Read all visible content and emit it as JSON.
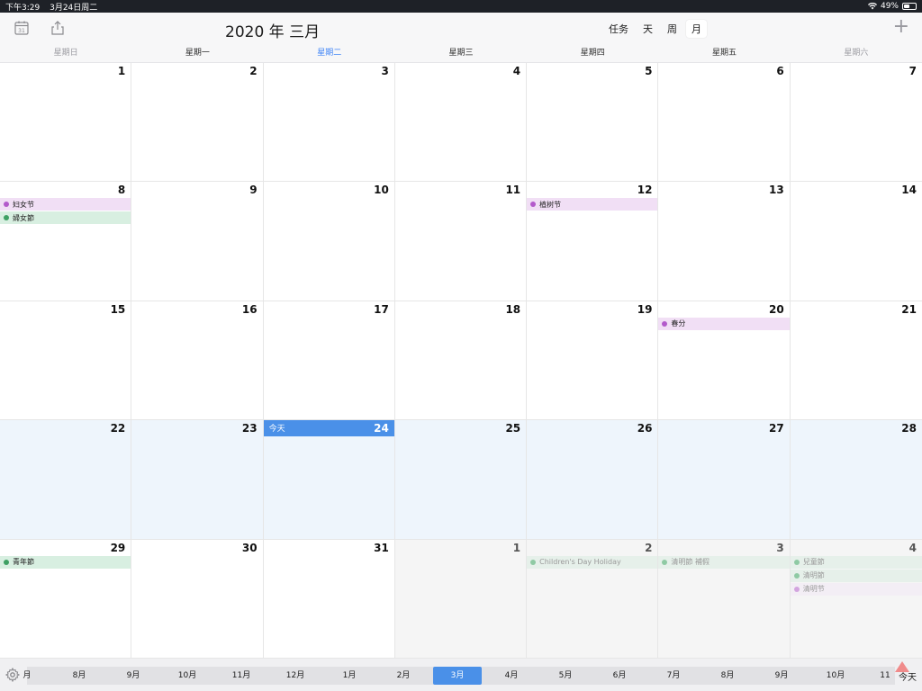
{
  "status_bar": {
    "time": "下午3:29",
    "date": "3月24日周二",
    "battery": "49%"
  },
  "header": {
    "title": "2020 年 三月",
    "views": [
      {
        "label": "任务",
        "active": false
      },
      {
        "label": "天",
        "active": false
      },
      {
        "label": "周",
        "active": false
      },
      {
        "label": "月",
        "active": true
      }
    ],
    "add_label": "+"
  },
  "weekdays": [
    {
      "label": "星期日",
      "weekend": true,
      "today": false
    },
    {
      "label": "星期一",
      "weekend": false,
      "today": false
    },
    {
      "label": "星期二",
      "weekend": false,
      "today": true
    },
    {
      "label": "星期三",
      "weekend": false,
      "today": false
    },
    {
      "label": "星期四",
      "weekend": false,
      "today": false
    },
    {
      "label": "星期五",
      "weekend": false,
      "today": false
    },
    {
      "label": "星期六",
      "weekend": true,
      "today": false
    }
  ],
  "today_label": "今天",
  "weeks": [
    [
      {
        "day": "1"
      },
      {
        "day": "2"
      },
      {
        "day": "3"
      },
      {
        "day": "4"
      },
      {
        "day": "5"
      },
      {
        "day": "6"
      },
      {
        "day": "7"
      }
    ],
    [
      {
        "day": "8",
        "events": [
          {
            "title": "妇女节",
            "color": "purple"
          },
          {
            "title": "婦女節",
            "color": "green"
          }
        ]
      },
      {
        "day": "9"
      },
      {
        "day": "10"
      },
      {
        "day": "11"
      },
      {
        "day": "12",
        "events": [
          {
            "title": "植树节",
            "color": "purple"
          }
        ]
      },
      {
        "day": "13"
      },
      {
        "day": "14"
      }
    ],
    [
      {
        "day": "15"
      },
      {
        "day": "16"
      },
      {
        "day": "17"
      },
      {
        "day": "18"
      },
      {
        "day": "19"
      },
      {
        "day": "20",
        "events": [
          {
            "title": "春分",
            "color": "purple"
          }
        ]
      },
      {
        "day": "21"
      }
    ],
    [
      {
        "day": "22",
        "current_week": true
      },
      {
        "day": "23",
        "current_week": true
      },
      {
        "day": "24",
        "current_week": true,
        "today": true
      },
      {
        "day": "25",
        "current_week": true
      },
      {
        "day": "26",
        "current_week": true
      },
      {
        "day": "27",
        "current_week": true
      },
      {
        "day": "28",
        "current_week": true
      }
    ],
    [
      {
        "day": "29",
        "events": [
          {
            "title": "青年節",
            "color": "green"
          }
        ]
      },
      {
        "day": "30"
      },
      {
        "day": "31"
      },
      {
        "day": "1",
        "other_month": true
      },
      {
        "day": "2",
        "other_month": true,
        "events": [
          {
            "title": "Children's Day Holiday",
            "color": "green"
          }
        ]
      },
      {
        "day": "3",
        "other_month": true,
        "events": [
          {
            "title": "清明節 補假",
            "color": "green"
          }
        ]
      },
      {
        "day": "4",
        "other_month": true,
        "events": [
          {
            "title": "兒童節",
            "color": "green"
          },
          {
            "title": "清明節",
            "color": "green"
          },
          {
            "title": "清明节",
            "color": "purple"
          }
        ]
      }
    ]
  ],
  "month_strip": [
    {
      "label": "月",
      "active": false
    },
    {
      "label": "8月",
      "active": false
    },
    {
      "label": "9月",
      "active": false
    },
    {
      "label": "10月",
      "active": false
    },
    {
      "label": "11月",
      "active": false
    },
    {
      "label": "12月",
      "active": false
    },
    {
      "label": "1月",
      "active": false
    },
    {
      "label": "2月",
      "active": false
    },
    {
      "label": "3月",
      "active": true
    },
    {
      "label": "4月",
      "active": false
    },
    {
      "label": "5月",
      "active": false
    },
    {
      "label": "6月",
      "active": false
    },
    {
      "label": "7月",
      "active": false
    },
    {
      "label": "8月",
      "active": false
    },
    {
      "label": "9月",
      "active": false
    },
    {
      "label": "10月",
      "active": false
    },
    {
      "label": "11",
      "active": false
    }
  ],
  "today_button": "今天",
  "icons": {
    "calendar": "calendar-icon",
    "share": "share-icon",
    "settings": "gear-icon",
    "wifi": "wifi-icon",
    "battery": "battery-icon"
  }
}
